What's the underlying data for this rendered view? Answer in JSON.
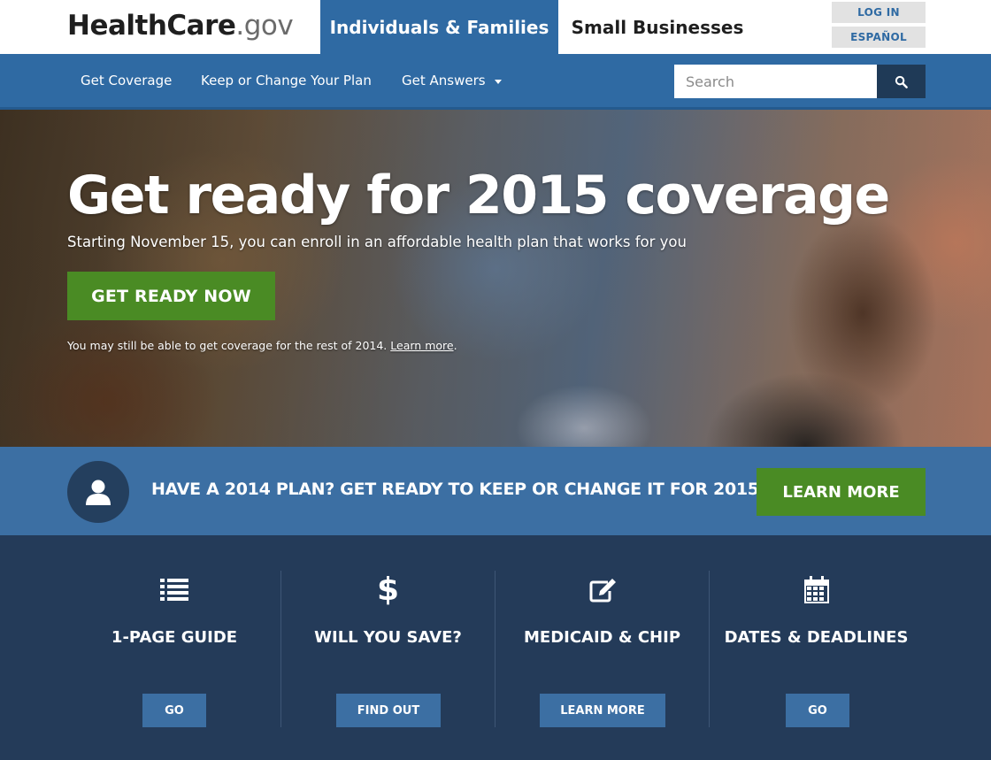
{
  "header": {
    "logo_main": "HealthCare",
    "logo_suffix": ".gov",
    "tab_individuals": "Individuals & Families",
    "tab_small_business": "Small Businesses",
    "login_label": "LOG IN",
    "espanol_label": "ESPAÑOL"
  },
  "nav": {
    "items": [
      {
        "label": "Get Coverage"
      },
      {
        "label": "Keep or Change Your Plan"
      },
      {
        "label": "Get Answers"
      }
    ],
    "search_placeholder": "Search",
    "search_icon": "search-icon"
  },
  "hero": {
    "title": "Get ready for 2015 coverage",
    "subtitle": "Starting November 15, you can enroll in an affordable health plan that works for you",
    "cta_label": "GET READY NOW",
    "note_text": "You may still be able to get coverage for the rest of 2014.",
    "note_link": "Learn more",
    "note_end": "."
  },
  "banner": {
    "icon": "person-icon",
    "text": "HAVE A 2014 PLAN? GET READY TO KEEP OR CHANGE IT FOR 2015",
    "button_label": "LEARN MORE"
  },
  "features": [
    {
      "icon": "list-icon",
      "title": "1-PAGE GUIDE",
      "button": "GO"
    },
    {
      "icon": "dollar-icon",
      "title": "WILL YOU SAVE?",
      "button": "FIND OUT"
    },
    {
      "icon": "edit-icon",
      "title": "MEDICAID & CHIP",
      "button": "LEARN MORE"
    },
    {
      "icon": "calendar-icon",
      "title": "DATES & DEADLINES",
      "button": "GO"
    }
  ],
  "colors": {
    "brand_blue": "#2f6aa3",
    "dark_navy": "#243b59",
    "cta_green": "#4a8b24"
  }
}
